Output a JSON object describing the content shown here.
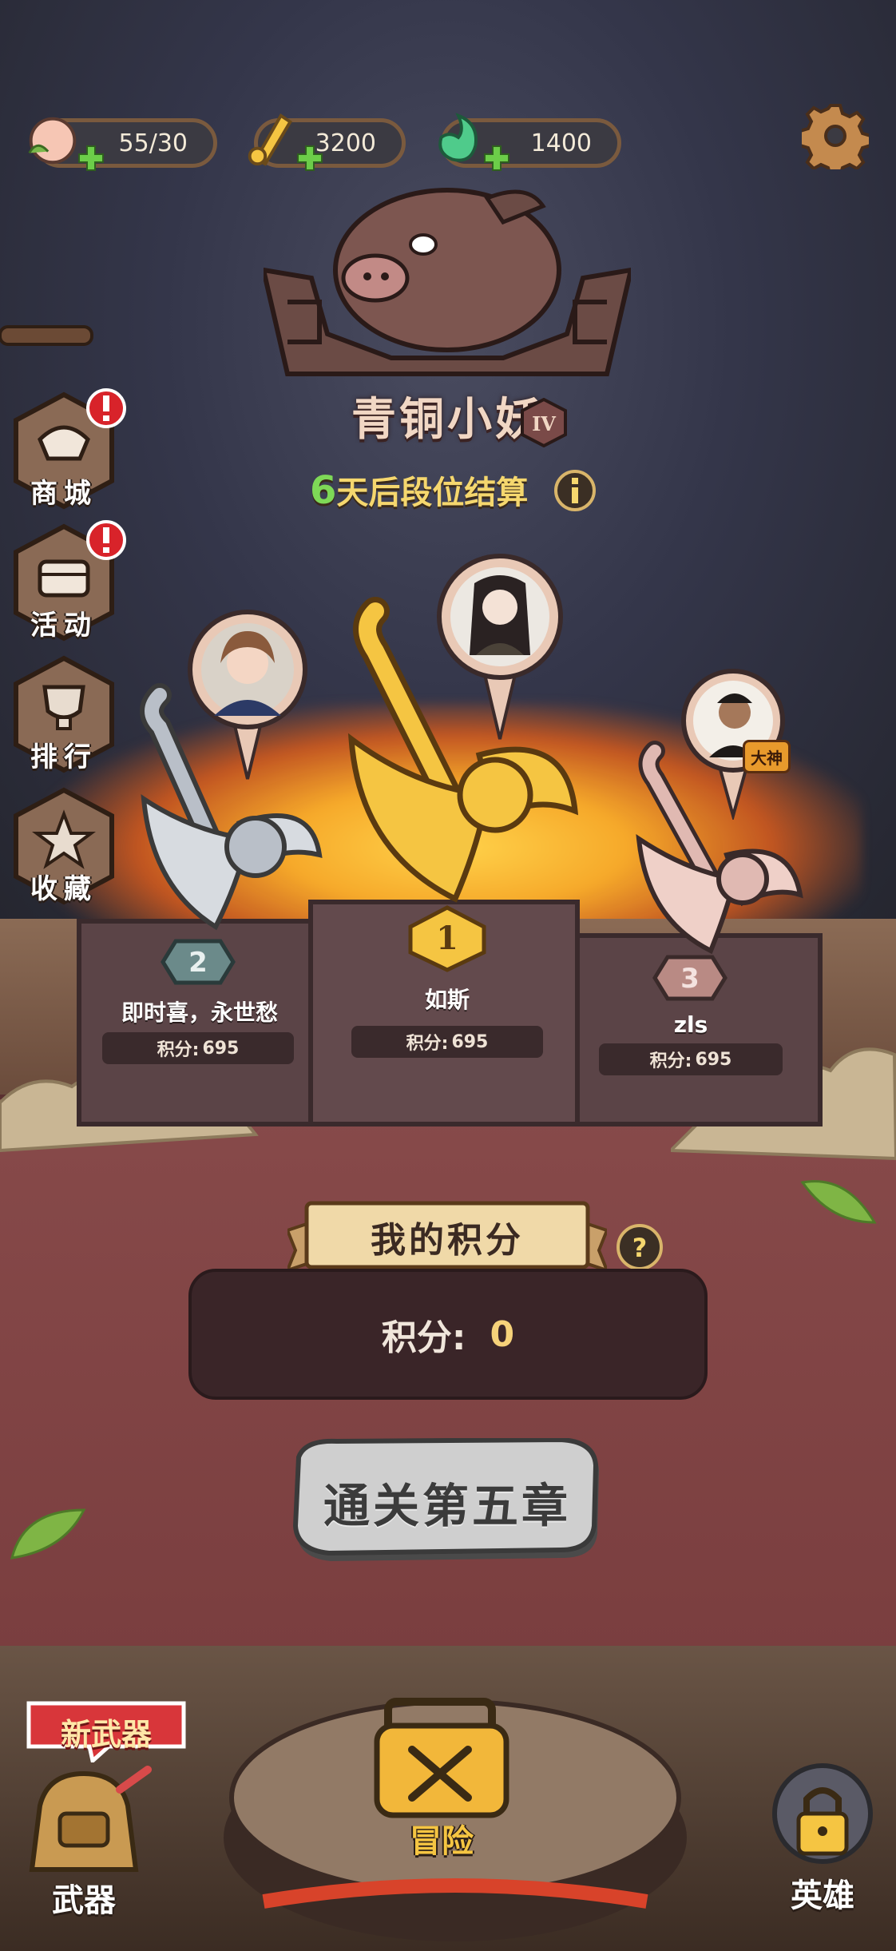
{
  "currencies": [
    {
      "icon": "peach-icon",
      "value": "55/30"
    },
    {
      "icon": "scroll-icon",
      "value": "3200"
    },
    {
      "icon": "jade-icon",
      "value": "1400"
    }
  ],
  "rank": {
    "title": "青铜小妖",
    "level": "IV",
    "settlement_days": "6",
    "settlement_text": "天后段位结算"
  },
  "side_menu": [
    {
      "label": "商城",
      "icon": "shop-icon",
      "badge": "!"
    },
    {
      "label": "活动",
      "icon": "chest-icon",
      "badge": "!"
    },
    {
      "label": "排行",
      "icon": "trophy-icon"
    },
    {
      "label": "收藏",
      "icon": "star-icon"
    }
  ],
  "podium": {
    "first": {
      "rank": "1",
      "name": "如斯",
      "score_label": "积分:",
      "score": "695"
    },
    "second": {
      "rank": "2",
      "name": "即时喜，永世愁",
      "score_label": "积分:",
      "score": "695"
    },
    "third": {
      "rank": "3",
      "name": "zls",
      "score_label": "积分:",
      "score": "695",
      "tag": "大神"
    }
  },
  "my_score": {
    "title": "我的积分",
    "label": "积分:",
    "value": "0",
    "help": "?"
  },
  "chapter_button": "通关第五章",
  "bottom_nav": {
    "weapon_badge": "新武器",
    "weapon": "武器",
    "adventure": "冒险",
    "hero": "英雄"
  },
  "colors": {
    "gold": "#f5c542",
    "silver": "#b9bfc8",
    "bronze": "#e0b9b2",
    "panel": "#7a3e3f"
  }
}
